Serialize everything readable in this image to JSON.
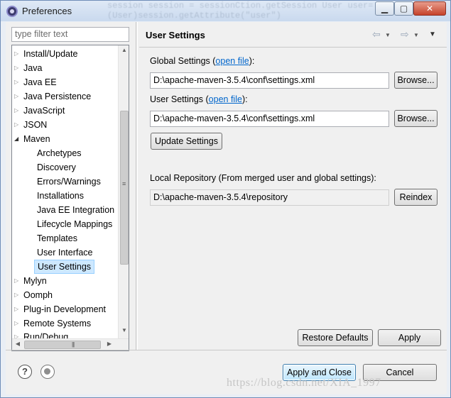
{
  "window": {
    "title": "Preferences",
    "background_ghost_text": "session session = sessionCtion.getSession\nUser user=(User)session.getAttribute(\"user\")"
  },
  "sidebar": {
    "filter_placeholder": "type filter text",
    "items": [
      {
        "label": "Install/Update",
        "level": 0,
        "expander": "collapsed"
      },
      {
        "label": "Java",
        "level": 0,
        "expander": "collapsed"
      },
      {
        "label": "Java EE",
        "level": 0,
        "expander": "collapsed"
      },
      {
        "label": "Java Persistence",
        "level": 0,
        "expander": "collapsed"
      },
      {
        "label": "JavaScript",
        "level": 0,
        "expander": "collapsed"
      },
      {
        "label": "JSON",
        "level": 0,
        "expander": "collapsed"
      },
      {
        "label": "Maven",
        "level": 0,
        "expander": "expanded"
      },
      {
        "label": "Archetypes",
        "level": 1
      },
      {
        "label": "Discovery",
        "level": 1
      },
      {
        "label": "Errors/Warnings",
        "level": 1
      },
      {
        "label": "Installations",
        "level": 1
      },
      {
        "label": "Java EE Integration",
        "level": 1
      },
      {
        "label": "Lifecycle Mappings",
        "level": 1
      },
      {
        "label": "Templates",
        "level": 1
      },
      {
        "label": "User Interface",
        "level": 1
      },
      {
        "label": "User Settings",
        "level": 1,
        "selected": true
      },
      {
        "label": "Mylyn",
        "level": 0,
        "expander": "collapsed"
      },
      {
        "label": "Oomph",
        "level": 0,
        "expander": "collapsed"
      },
      {
        "label": "Plug-in Development",
        "level": 0,
        "expander": "collapsed"
      },
      {
        "label": "Remote Systems",
        "level": 0,
        "expander": "collapsed"
      },
      {
        "label": "Run/Debug",
        "level": 0,
        "expander": "collapsed"
      }
    ]
  },
  "page": {
    "title": "User Settings",
    "global_label": "Global Settings (",
    "global_link": "open file",
    "global_label_end": "):",
    "global_value": "D:\\apache-maven-3.5.4\\conf\\settings.xml",
    "user_label": "User Settings (",
    "user_link": "open file",
    "user_label_end": "):",
    "user_value": "D:\\apache-maven-3.5.4\\conf\\settings.xml",
    "browse_label": "Browse...",
    "update_label": "Update Settings",
    "local_repo_label": "Local Repository (From merged user and global settings):",
    "local_repo_value": "D:\\apache-maven-3.5.4\\repository",
    "reindex_label": "Reindex",
    "restore_label": "Restore Defaults",
    "apply_label": "Apply"
  },
  "footer": {
    "apply_close_label": "Apply and Close",
    "cancel_label": "Cancel",
    "watermark": "https://blog.csdn.net/XIA_1997"
  }
}
